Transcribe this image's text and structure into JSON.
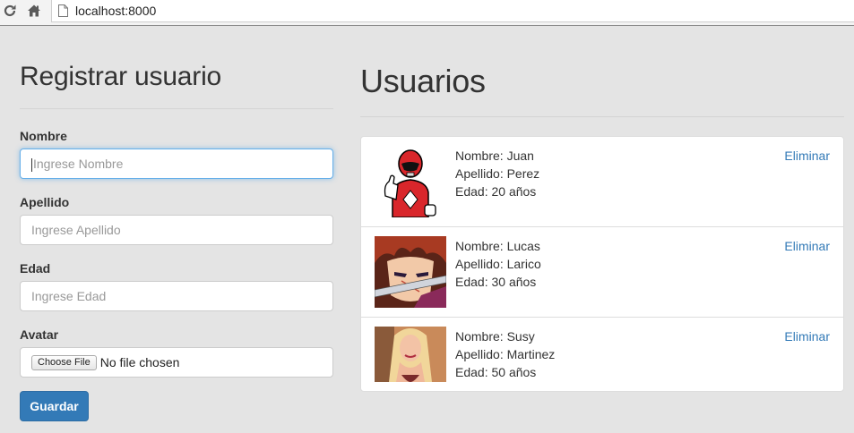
{
  "browser": {
    "url": "localhost:8000"
  },
  "form": {
    "title": "Registrar usuario",
    "fields": [
      {
        "label": "Nombre",
        "placeholder": "Ingrese Nombre"
      },
      {
        "label": "Apellido",
        "placeholder": "Ingrese Apellido"
      },
      {
        "label": "Edad",
        "placeholder": "Ingrese Edad"
      }
    ],
    "avatar": {
      "label": "Avatar",
      "button": "Choose File",
      "status": "No file chosen"
    },
    "save_label": "Guardar"
  },
  "users": {
    "title": "Usuarios",
    "delete_label": "Eliminar",
    "list": [
      {
        "nombre": "Nombre: Juan",
        "apellido": "Apellido: Perez",
        "edad": "Edad: 20 años",
        "avatar_icon": "red-ranger-avatar"
      },
      {
        "nombre": "Nombre: Lucas",
        "apellido": "Apellido: Larico",
        "edad": "Edad: 30 años",
        "avatar_icon": "anime-swordsman-avatar"
      },
      {
        "nombre": "Nombre: Susy",
        "apellido": "Apellido: Martinez",
        "edad": "Edad: 50 años",
        "avatar_icon": "blonde-woman-avatar"
      }
    ]
  },
  "colors": {
    "primary": "#337ab7",
    "background": "#e4e4e4"
  }
}
